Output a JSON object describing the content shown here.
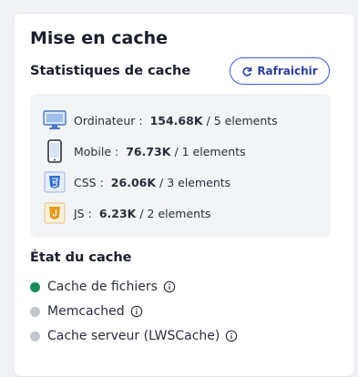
{
  "card": {
    "title": "Mise en cache",
    "stats_title": "Statistiques de cache",
    "refresh_label": "Rafraichir"
  },
  "stats": [
    {
      "icon": "desktop-icon",
      "name": "Ordinateur :",
      "size": "154.68K",
      "count": "/ 5 elements"
    },
    {
      "icon": "mobile-icon",
      "name": "Mobile :",
      "size": "76.73K",
      "count": "/ 1 elements"
    },
    {
      "icon": "css-file-icon",
      "name": "CSS :",
      "size": "26.06K",
      "count": "/ 3 elements"
    },
    {
      "icon": "js-file-icon",
      "name": "JS :",
      "size": "6.23K",
      "count": "/ 2 elements"
    }
  ],
  "state": {
    "title": "État du cache",
    "items": [
      {
        "label": "Cache de fichiers",
        "status_color": "#1a8a5a",
        "active": true
      },
      {
        "label": "Memcached",
        "status_color": "#c3c6ce",
        "active": false
      },
      {
        "label": "Cache serveur (LWSCache)",
        "status_color": "#c3c6ce",
        "active": false
      }
    ]
  },
  "colors": {
    "accent": "#3a5bd6",
    "active_green": "#1a8a5a",
    "inactive_gray": "#c3c6ce"
  }
}
